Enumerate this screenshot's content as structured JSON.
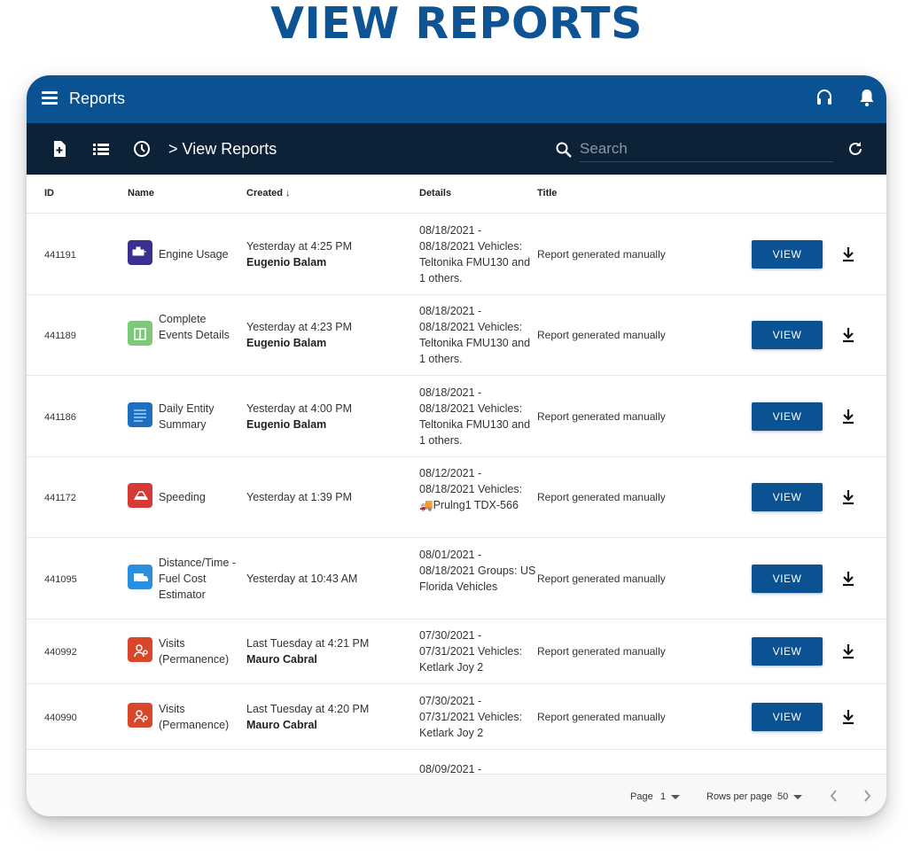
{
  "hero": {
    "title": "VIEW REPORTS"
  },
  "appbar": {
    "title": "Reports",
    "icons": [
      "menu-icon",
      "headset-icon",
      "bell-icon"
    ]
  },
  "toolbar": {
    "breadcrumb": "> View Reports",
    "search_placeholder": "Search",
    "icons": [
      "new-report-icon",
      "list-icon",
      "clock-icon",
      "search-icon",
      "refresh-icon"
    ]
  },
  "table": {
    "headers": {
      "id": "ID",
      "name": "Name",
      "created": "Created ↓",
      "details": "Details",
      "title": "Title"
    },
    "view_label": "VIEW",
    "rows": [
      {
        "id": "441191",
        "icon": "engine-usage-icon",
        "icon_color": "#3b2f8f",
        "name": "Engine Usage",
        "created": "Yesterday at 4:25 PM",
        "by": "Eugenio Balam",
        "details": "08/18/2021 - 08/18/2021 Vehicles: Teltonika FMU130 and 1 others.",
        "title": "Report generated manually"
      },
      {
        "id": "441189",
        "icon": "complete-events-icon",
        "icon_color": "#7cc97a",
        "name": "Complete Events Details",
        "created": "Yesterday at 4:23 PM",
        "by": "Eugenio Balam",
        "details": "08/18/2021 - 08/18/2021 Vehicles: Teltonika FMU130 and 1 others.",
        "title": "Report generated manually"
      },
      {
        "id": "441186",
        "icon": "daily-summary-icon",
        "icon_color": "#1e6fbf",
        "name": "Daily Entity Summary",
        "created": "Yesterday at 4:00 PM",
        "by": "Eugenio Balam",
        "details": "08/18/2021 - 08/18/2021 Vehicles: Teltonika FMU130 and 1 others.",
        "title": "Report generated manually"
      },
      {
        "id": "441172",
        "icon": "speeding-icon",
        "icon_color": "#d63a36",
        "name": "Speeding",
        "created": "Yesterday at 1:39 PM",
        "by": "",
        "details": "08/12/2021 - 08/18/2021 Vehicles: 🚚Prulng1 TDX-566",
        "title": "Report generated manually"
      },
      {
        "id": "441095",
        "icon": "fuel-cost-icon",
        "icon_color": "#2b8fe0",
        "name": "Distance/Time - Fuel Cost Estimator",
        "created": "Yesterday at 10:43 AM",
        "by": "",
        "details": "08/01/2021 - 08/18/2021 Groups: US Florida Vehicles",
        "title": "Report generated manually"
      },
      {
        "id": "440992",
        "icon": "visits-icon",
        "icon_color": "#d9472b",
        "name": "Visits (Permanence)",
        "created": "Last Tuesday at 4:21 PM",
        "by": "Mauro Cabral",
        "details": "07/30/2021 - 07/31/2021 Vehicles: Ketlark Joy 2",
        "title": "Report generated manually"
      },
      {
        "id": "440990",
        "icon": "visits-icon",
        "icon_color": "#d9472b",
        "name": "Visits (Permanence)",
        "created": "Last Tuesday at 4:20 PM",
        "by": "Mauro Cabral",
        "details": "07/30/2021 - 07/31/2021 Vehicles: Ketlark Joy 2",
        "title": "Report generated manually"
      }
    ],
    "partial_row": {
      "details": "08/09/2021 -"
    }
  },
  "footer": {
    "page_label": "Page",
    "page_value": "1",
    "rows_label": "Rows per page",
    "rows_value": "50"
  }
}
